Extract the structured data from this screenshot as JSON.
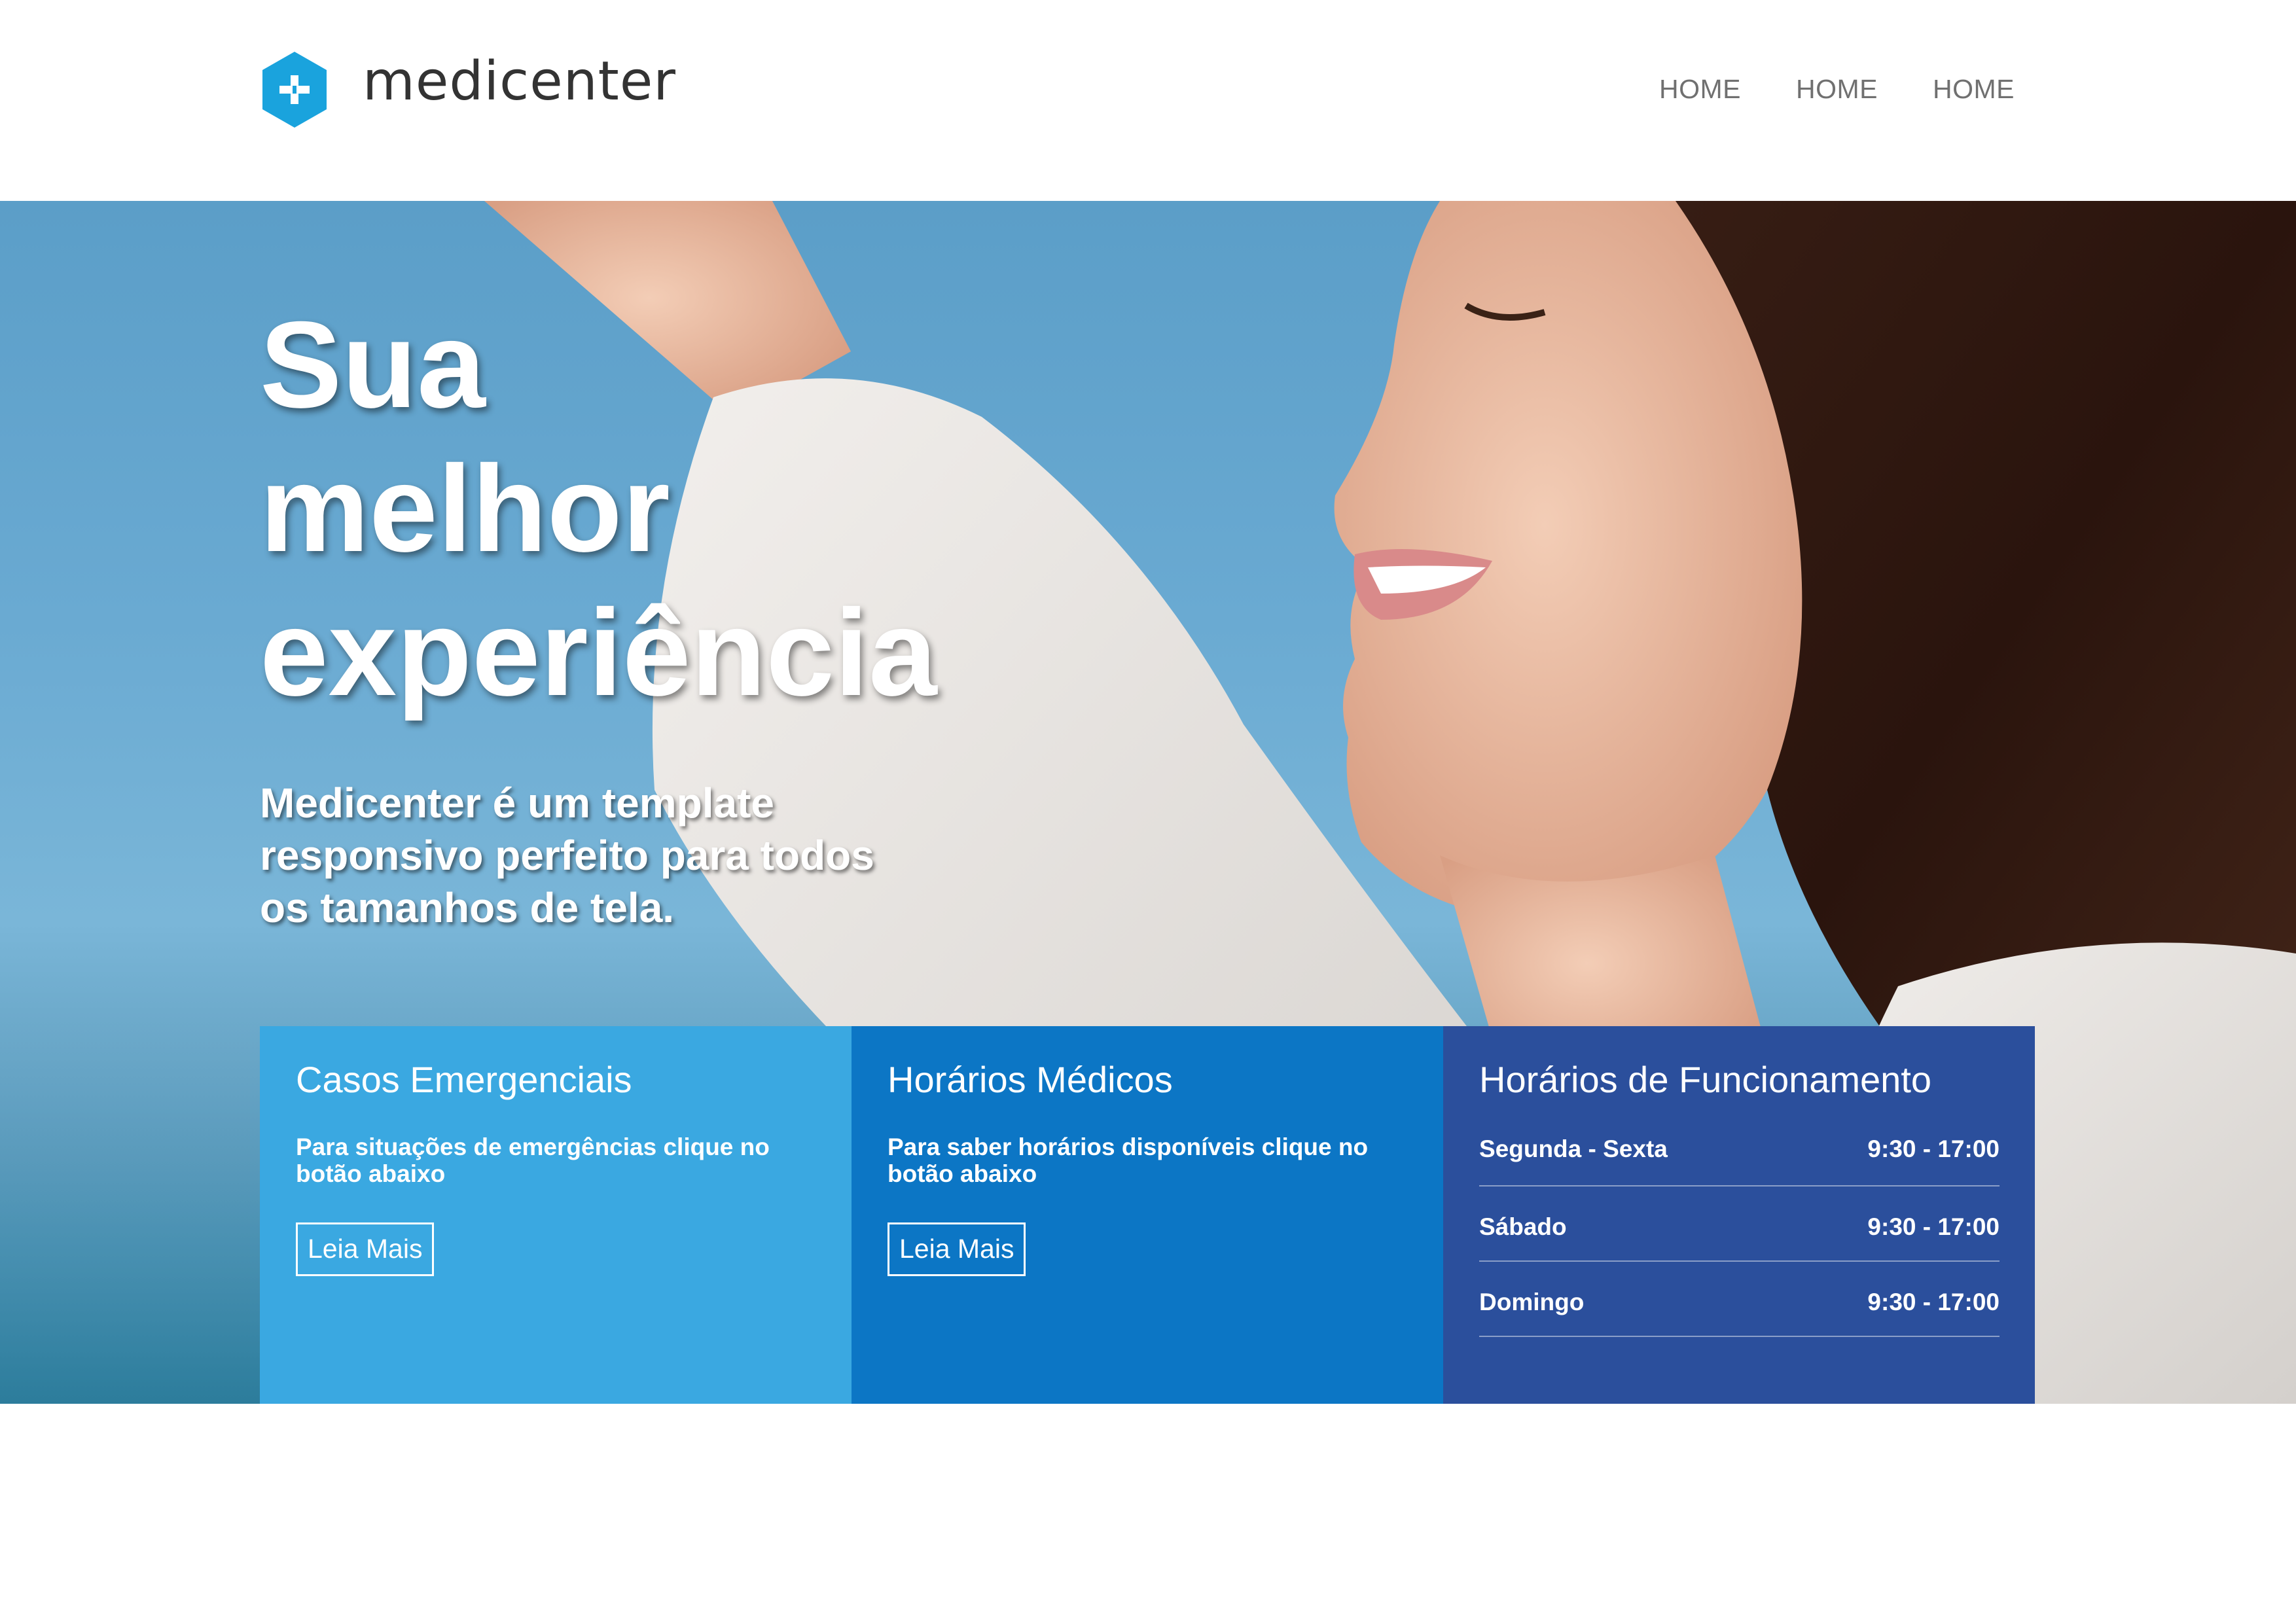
{
  "brand": {
    "name": "medicenter",
    "accent": "#1aa3dd"
  },
  "nav": {
    "items": [
      "HOME",
      "HOME",
      "HOME"
    ]
  },
  "hero": {
    "title_lines": [
      "Sua",
      "melhor",
      "experiência"
    ],
    "subtitle_lines": [
      "Medicenter é um template",
      "responsivo perfeito para todos",
      "os tamanhos de tela."
    ]
  },
  "boxes": {
    "emergency": {
      "title": "Casos Emergenciais",
      "text": "Para situações de emergências clique no botão abaixo",
      "button": "Leia Mais",
      "color": "#3aa8e1"
    },
    "schedule": {
      "title": "Horários Médicos",
      "text": "Para saber horários disponíveis clique no botão abaixo",
      "button": "Leia Mais",
      "color": "#0c76c5"
    },
    "hours": {
      "title": "Horários de Funcionamento",
      "color": "#2b4f9c",
      "rows": [
        {
          "day": "Segunda - Sexta",
          "time": "9:30 - 17:00"
        },
        {
          "day": "Sábado",
          "time": "9:30 - 17:00"
        },
        {
          "day": "Domingo",
          "time": "9:30 - 17:00"
        }
      ]
    }
  },
  "icons": {
    "logo": "medical-plus-hexagon-icon"
  }
}
